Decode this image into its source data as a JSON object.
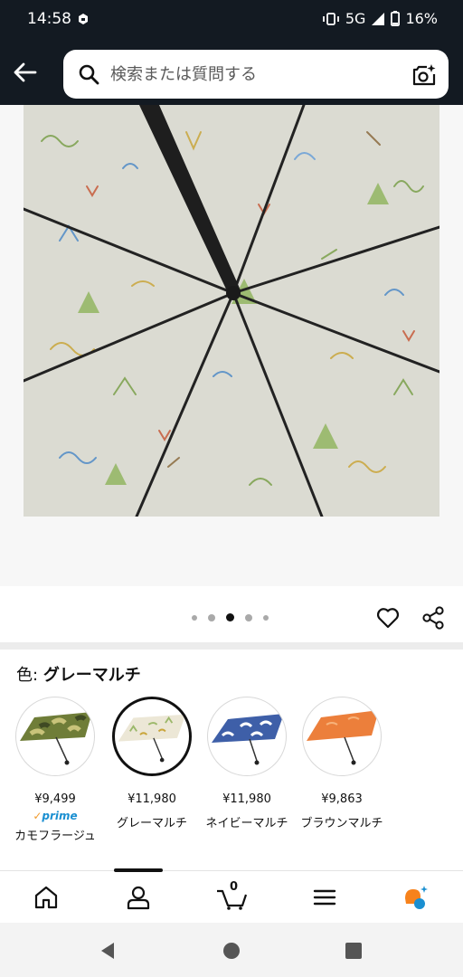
{
  "status_bar": {
    "time": "14:58",
    "network": "5G",
    "battery": "16%"
  },
  "header": {
    "search_placeholder": "検索または質問する",
    "icons": [
      "back-arrow-icon",
      "search-icon",
      "camera-search-icon"
    ]
  },
  "product_image": {
    "alt": "umbrella",
    "carousel_total": 5,
    "carousel_active_index": 2
  },
  "color_section": {
    "label": "色:",
    "selected_value": "グレーマルチ",
    "variants": [
      {
        "price": "¥9,499",
        "prime": "prime",
        "name": "カモフラージュ",
        "selected": false,
        "color": "#6f7d38"
      },
      {
        "price": "¥11,980",
        "prime": "",
        "name": "グレーマルチ",
        "selected": true,
        "color": "#ece7d6"
      },
      {
        "price": "¥11,980",
        "prime": "",
        "name": "ネイビーマルチ",
        "selected": false,
        "color": "#3e5fa8"
      },
      {
        "price": "¥9,863",
        "prime": "",
        "name": "ブラウンマルチ",
        "selected": false,
        "color": "#ec7f3b"
      }
    ]
  },
  "bottom_nav": {
    "cart_count": "0",
    "items": [
      "home-icon",
      "account-icon",
      "cart-icon",
      "menu-icon",
      "rufus-icon"
    ]
  },
  "colors": {
    "header_bg": "#131a22",
    "accent": "#f19c2e",
    "prime_blue": "#1a8fd1"
  }
}
